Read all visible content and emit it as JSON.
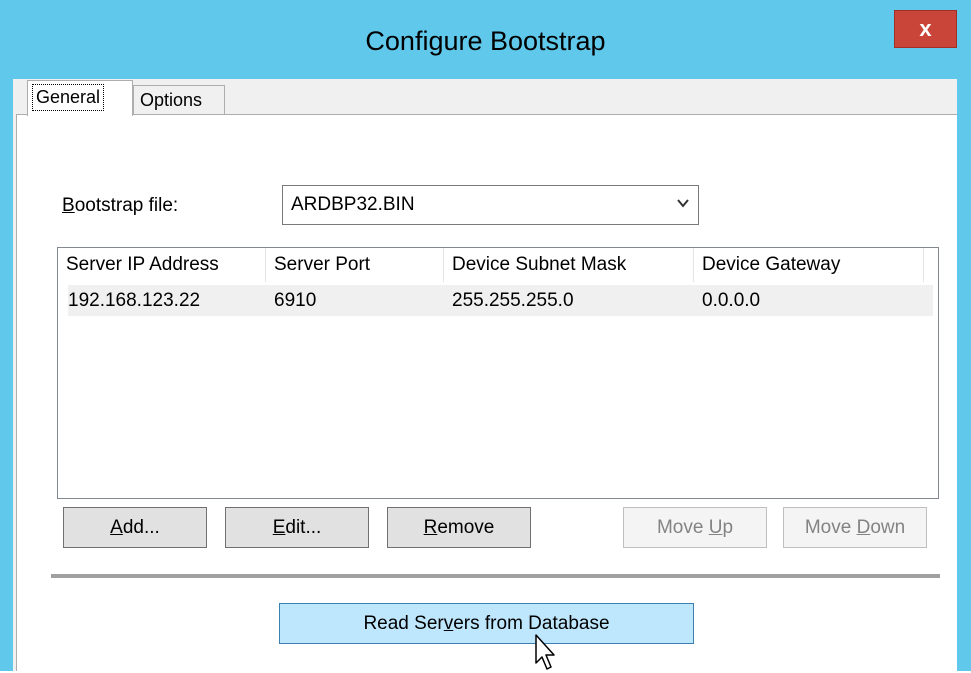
{
  "window": {
    "title": "Configure Bootstrap",
    "close_glyph": "x"
  },
  "tabs": {
    "general": "General",
    "options": "Options"
  },
  "bootstrap": {
    "label_underlined": "B",
    "label_rest": "ootstrap file:",
    "value": "ARDBP32.BIN"
  },
  "servers": {
    "columns": [
      "Server IP Address",
      "Server Port",
      "Device Subnet Mask",
      "Device Gateway"
    ],
    "rows": [
      [
        "192.168.123.22",
        "6910",
        "255.255.255.0",
        "0.0.0.0"
      ]
    ]
  },
  "buttons": {
    "add": {
      "u": "A",
      "rest": "dd..."
    },
    "edit": {
      "u": "E",
      "rest": "dit..."
    },
    "remove": {
      "u": "R",
      "rest": "emove"
    },
    "move_up": {
      "pre": "Move ",
      "u": "U",
      "rest": "p"
    },
    "move_down": {
      "pre": "Move ",
      "u": "D",
      "rest": "own"
    },
    "read_servers": {
      "pre": "Read Ser",
      "u": "v",
      "rest": "ers from Database"
    }
  },
  "colors": {
    "title_bar": "#60c8ea",
    "close_button": "#c9453a",
    "primary_button": "#bee6fd"
  },
  "icons": {
    "close": "close-icon",
    "dropdown": "chevron-down-icon",
    "cursor": "mouse-pointer-icon"
  }
}
